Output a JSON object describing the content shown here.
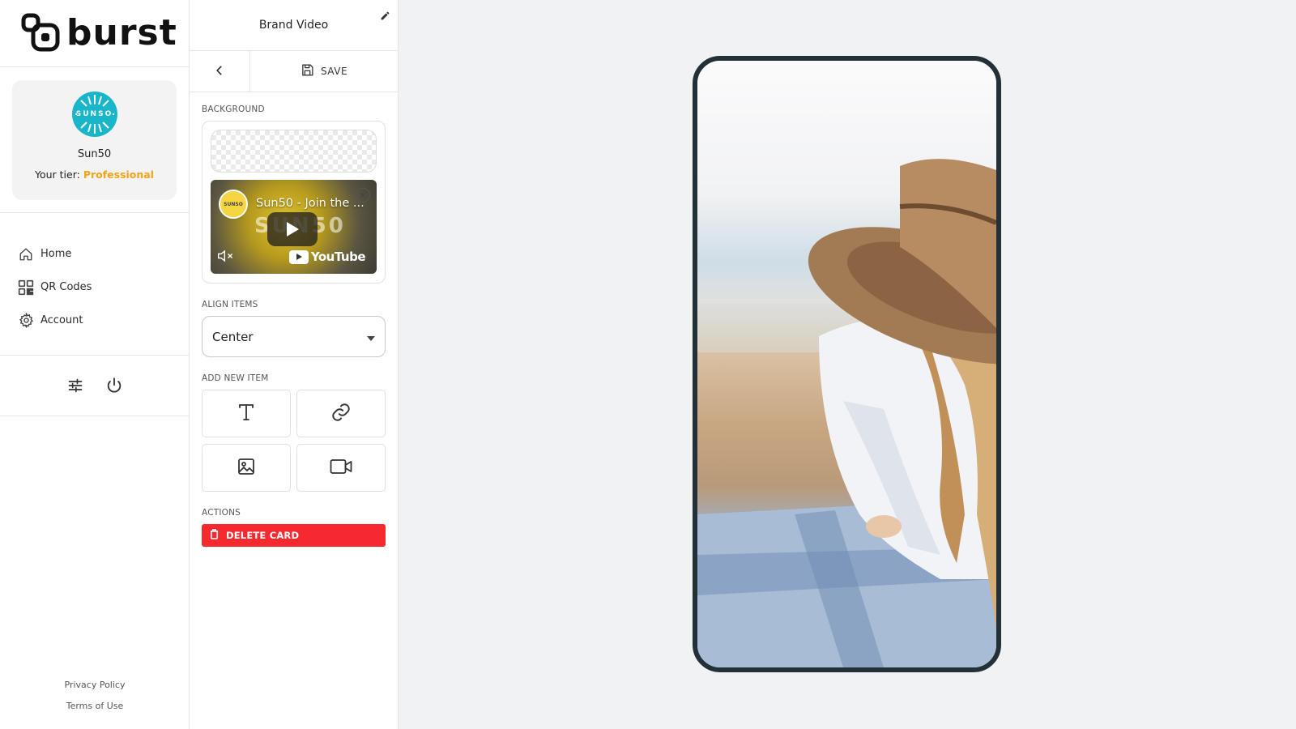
{
  "brand": {
    "name": "burst"
  },
  "profile": {
    "avatar_text": "SUNSO",
    "name": "Sun50",
    "tier_label": "Your tier:",
    "tier_value": "Professional"
  },
  "nav": {
    "items": [
      {
        "label": "Home",
        "icon": "home-icon"
      },
      {
        "label": "QR Codes",
        "icon": "qr-code-icon"
      },
      {
        "label": "Account",
        "icon": "gear-icon"
      }
    ]
  },
  "tools": {
    "icons": [
      "sliders-icon",
      "power-icon"
    ]
  },
  "legal": {
    "privacy": "Privacy Policy",
    "terms": "Terms of Use"
  },
  "editor": {
    "title": "Brand Video",
    "save_label": "SAVE",
    "background_label": "BACKGROUND",
    "video": {
      "channel_logo_text": "SUNSO",
      "title": "Sun50 - Join the ...",
      "watermark": "SUN50",
      "platform": "YouTube"
    },
    "align_label": "ALIGN ITEMS",
    "align_value": "Center",
    "add_label": "ADD NEW ITEM",
    "add_items": [
      "text-icon",
      "link-icon",
      "image-icon",
      "video-icon"
    ],
    "actions_label": "ACTIONS",
    "delete_label": "DELETE CARD"
  },
  "colors": {
    "accent_tier": "#f3a516",
    "delete": "#f5292e",
    "avatar": "#19b5c9",
    "phone_frame": "#243038"
  }
}
